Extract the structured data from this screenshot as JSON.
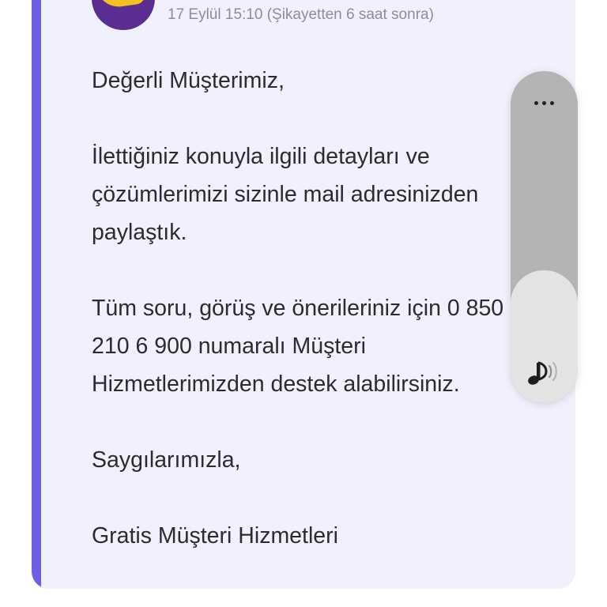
{
  "message": {
    "timestamp_line": "17 Eylül 15:10 (Şikayetten 6 saat sonra)",
    "greeting": "Değerli Müşterimiz,",
    "paragraph_1": "İlettiğiniz konuyla ilgili detayları ve çözümlerimizi sizinle mail adresinizden paylaştık.",
    "paragraph_2": "Tüm soru, görüş ve önerileriniz için 0 850 210 6 900 numaralı Müşteri Hizmetlerimizden destek alabilirsiniz.",
    "closing": "Saygılarımızla,",
    "signature": "Gratis Müşteri Hizmetleri"
  },
  "volume_overlay": {
    "level_percent": 40,
    "icons": {
      "more": "more-dots-icon",
      "speaker": "speaker-volume-icon"
    }
  },
  "colors": {
    "card_background": "#f1f1fd",
    "accent_bar": "#6e5fe6",
    "avatar_purple": "#5a2d91",
    "avatar_yellow": "#f4c21f",
    "meta_text": "#8d8d99",
    "body_text": "#2b2b33"
  }
}
